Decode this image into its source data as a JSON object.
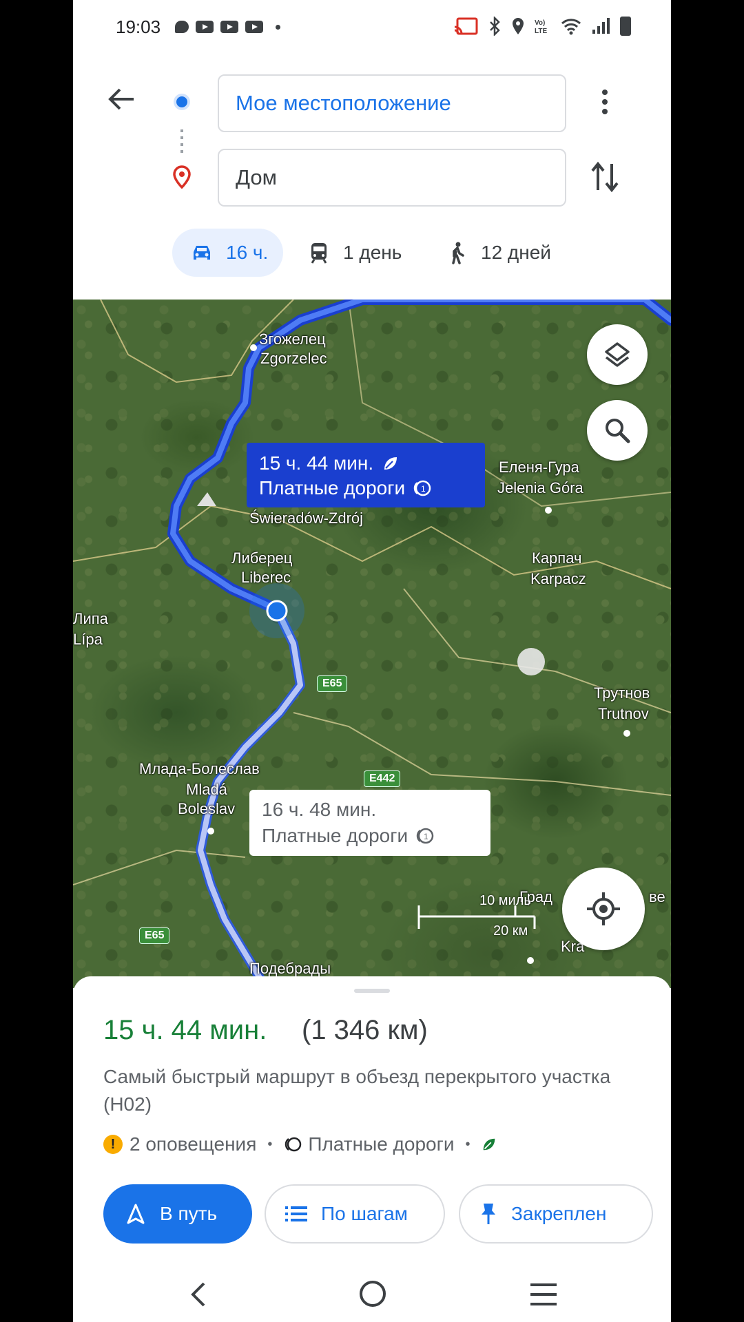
{
  "status_bar": {
    "time": "19:03"
  },
  "search": {
    "origin": "Мое местоположение",
    "destination": "Дом"
  },
  "modes": [
    {
      "name": "car",
      "label": "16 ч.",
      "active": true
    },
    {
      "name": "transit",
      "label": "1 день",
      "active": false
    },
    {
      "name": "walk",
      "label": "12 дней",
      "active": false
    }
  ],
  "map": {
    "labels": {
      "zgorzelec_ru": "Згожелец",
      "zgorzelec": "Zgorzelec",
      "jelenia_ru": "Еленя-Гура",
      "jelenia": "Jelenia Góra",
      "swieradow": "Świeradów-Zdrój",
      "liberec_ru": "Либерец",
      "liberec": "Liberec",
      "karpacz_ru": "Карпач",
      "karpacz": "Karpacz",
      "lipa_ru": "Липа",
      "lipa": "Lípa",
      "trutnov_ru": "Трутнов",
      "trutnov": "Trutnov",
      "mlada_ru": "Млада-Болеслав",
      "mlada_1": "Mladá",
      "mlada_2": "Boleslav",
      "hradec": "Град",
      "hradec_tail": "ве",
      "kralove": "Kra",
      "podebrady": "Подебрады"
    },
    "shields": {
      "e65_a": "E65",
      "e442": "E442",
      "e65_b": "E65"
    },
    "primary_callout": {
      "time": "15 ч. 44 мин.",
      "tolls": "Платные дороги"
    },
    "alt_callout": {
      "time": "16 ч. 48 мин.",
      "tolls": "Платные дороги"
    },
    "scale": {
      "miles": "10 миль",
      "km": "20 км"
    }
  },
  "route": {
    "duration": "15 ч. 44 мин.",
    "distance": "(1 346 км)",
    "description": "Самый быстрый маршрут в объезд перекрытого участка (H02)",
    "alerts": "2 оповещения",
    "tolls": "Платные дороги"
  },
  "actions": {
    "start": "В путь",
    "steps": "По шагам",
    "pinned": "Закреплен"
  },
  "colors": {
    "accent": "#1a73e8",
    "route": "#1a3fcf",
    "duration": "#188038"
  }
}
